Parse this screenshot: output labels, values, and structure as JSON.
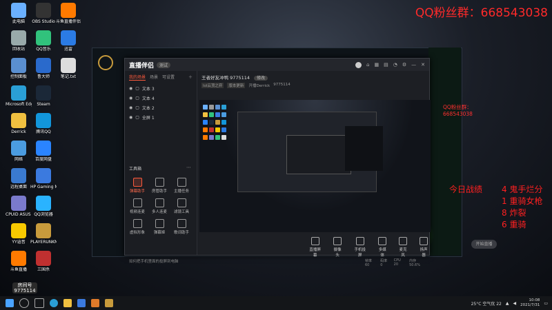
{
  "overlay": {
    "qq_group": "QQ粉丝群：668543038",
    "stats_title": "今日战绩",
    "stats_lines": [
      "4 鬼手烂分",
      "1 重骑女枪",
      "8 炸裂",
      "6 重骑"
    ]
  },
  "desktop_icons": [
    {
      "label": "此电脑",
      "color": "#6ab0ff"
    },
    {
      "label": "回收站",
      "color": "#9aa"
    },
    {
      "label": "控制面板",
      "color": "#5a8fd0"
    },
    {
      "label": "Microsoft Edge",
      "color": "#2a9fd6"
    },
    {
      "label": "Derrick",
      "color": "#f0c040"
    },
    {
      "label": "网络",
      "color": "#4b9ce0"
    },
    {
      "label": "远程桌面",
      "color": "#3a7ad0"
    },
    {
      "label": "CPUID ASUS CPU-Z",
      "color": "#7a7acc"
    },
    {
      "label": "YY语音",
      "color": "#f7c900"
    },
    {
      "label": "斗鱼直播",
      "color": "#ff7a00"
    },
    {
      "label": "OBS Studio",
      "color": "#333"
    },
    {
      "label": "QQ音乐",
      "color": "#31c27c"
    },
    {
      "label": "鲁大师",
      "color": "#2a6acc"
    },
    {
      "label": "Steam",
      "color": "#1b2838"
    },
    {
      "label": "腾讯QQ",
      "color": "#1296db"
    },
    {
      "label": "百度网盘",
      "color": "#2a84ff"
    },
    {
      "label": "HP Gaming Mouse",
      "color": "#3b7adf"
    },
    {
      "label": "QQ浏览器",
      "color": "#2ab3ff"
    },
    {
      "label": "PLAYERUNKNOWN'S BATTLEGROUNDS",
      "color": "#c89b3c"
    },
    {
      "label": "三国杀",
      "color": "#c03030"
    },
    {
      "label": "斗鱼直播伴侣",
      "color": "#ff7a00"
    },
    {
      "label": "迅雷",
      "color": "#2b7be4"
    },
    {
      "label": "笔记.txt",
      "color": "#dddddd"
    }
  ],
  "app": {
    "logo": "直播伴侣",
    "version_badge": "测试",
    "left_tabs": [
      "我的场景",
      "场景",
      "可设置"
    ],
    "sources": [
      "文本 3",
      "文本 4",
      "文本 2",
      "全屏 1"
    ],
    "tools_title": "工具箱",
    "tools": [
      {
        "label": "弹幕助手",
        "red": true
      },
      {
        "label": "房管助手",
        "red": false
      },
      {
        "label": "主播任务",
        "red": false
      },
      {
        "label": "视频连麦",
        "red": false
      },
      {
        "label": "多人连麦",
        "red": false
      },
      {
        "label": "滤镜工具",
        "red": false
      },
      {
        "label": "虚拟形象",
        "red": false
      },
      {
        "label": "弹幕姬",
        "red": false
      },
      {
        "label": "歌词助手",
        "red": false
      }
    ],
    "hint": "如何把手机里面的投屏到电脑",
    "room_title": "王者好友冲鸭 9775114",
    "room_tag": "修改",
    "room_sub": [
      "lol云顶之弈",
      "版本更新",
      "开播Derrick",
      "9775114"
    ],
    "bottom_buttons": [
      "直播屏幕",
      "摄像头",
      "手机投屏",
      "多媒体",
      "麦克风",
      "扬声器"
    ],
    "start_button": "开始直播",
    "status_items": [
      "帧率 60",
      "码率 0",
      "CPU 20",
      "内存 50.6%"
    ]
  },
  "streamer_badge": {
    "line1": "房间号",
    "line2": "9775114"
  },
  "taskbar": {
    "weather": "25°C 空气优 22",
    "time": "10:08",
    "date": "2021/7/31"
  }
}
